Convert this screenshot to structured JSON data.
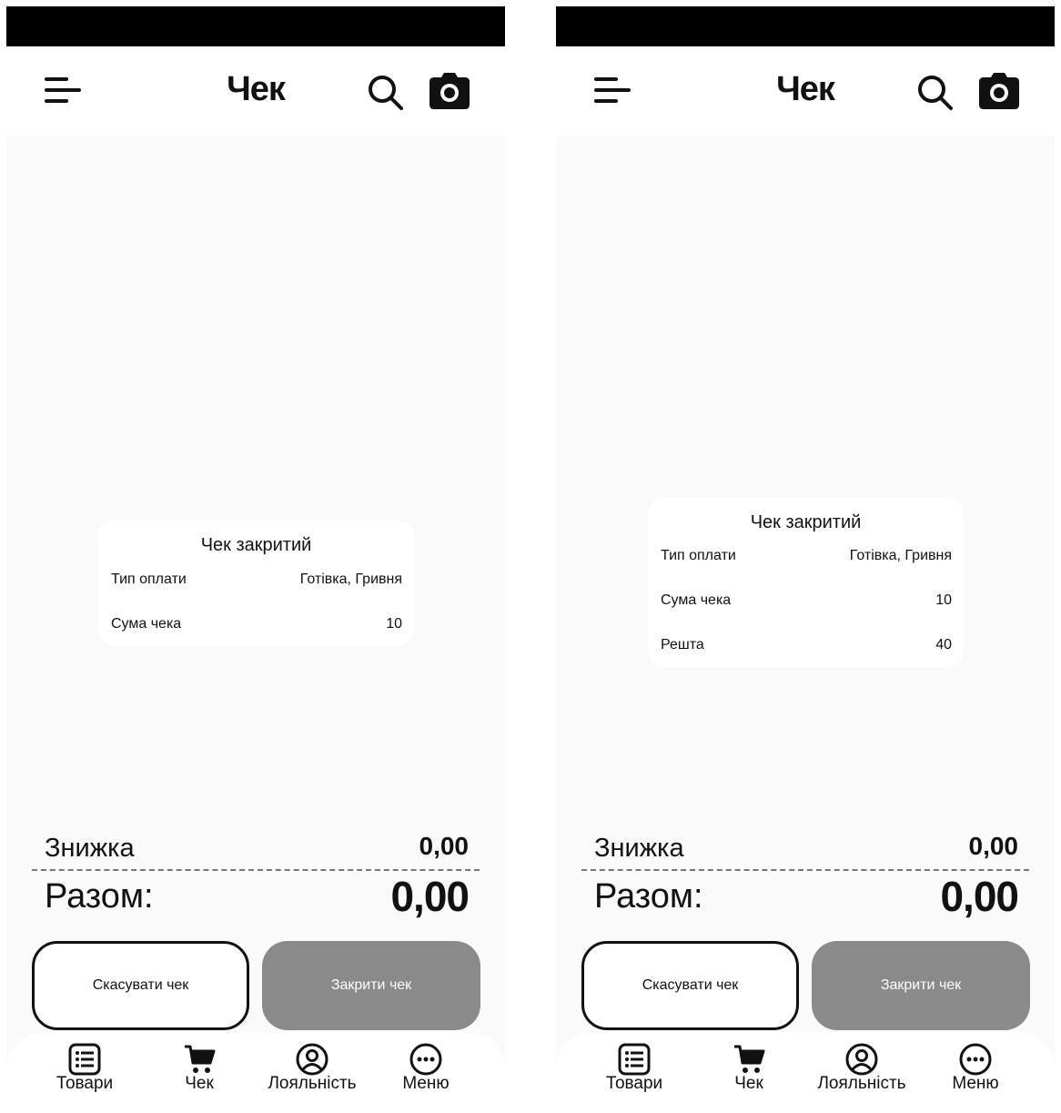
{
  "screens": [
    {
      "header": {
        "title": "Чек",
        "search_icon": "search-icon",
        "camera_icon": "camera-icon",
        "menu_icon": "hamburger-menu-icon"
      },
      "receipt": {
        "title": "Чек закритий",
        "rows": [
          {
            "label": "Тип оплати",
            "value": "Готівка, Гривня"
          },
          {
            "label": "Сума чека",
            "value": "10"
          }
        ]
      },
      "totals": {
        "discount_label": "Знижка",
        "discount_value": "0,00",
        "total_label": "Разом:",
        "total_value": "0,00"
      },
      "actions": {
        "cancel_label": "Скасувати чек",
        "close_label": "Закрити чек"
      },
      "nav": [
        {
          "label": "Товари",
          "icon": "list-icon"
        },
        {
          "label": "Чек",
          "icon": "cart-icon"
        },
        {
          "label": "Лояльність",
          "icon": "user-circle-icon"
        },
        {
          "label": "Меню",
          "icon": "more-dots-icon"
        }
      ]
    },
    {
      "header": {
        "title": "Чек",
        "search_icon": "search-icon",
        "camera_icon": "camera-icon",
        "menu_icon": "hamburger-menu-icon"
      },
      "receipt": {
        "title": "Чек закритий",
        "rows": [
          {
            "label": "Тип оплати",
            "value": "Готівка, Гривня"
          },
          {
            "label": "Сума чека",
            "value": "10"
          },
          {
            "label": "Решта",
            "value": "40"
          }
        ]
      },
      "totals": {
        "discount_label": "Знижка",
        "discount_value": "0,00",
        "total_label": "Разом:",
        "total_value": "0,00"
      },
      "actions": {
        "cancel_label": "Скасувати чек",
        "close_label": "Закрити чек"
      },
      "nav": [
        {
          "label": "Товари",
          "icon": "list-icon"
        },
        {
          "label": "Чек",
          "icon": "cart-icon"
        },
        {
          "label": "Лояльність",
          "icon": "user-circle-icon"
        },
        {
          "label": "Меню",
          "icon": "more-dots-icon"
        }
      ]
    }
  ],
  "colors": {
    "status_bar": "#000000",
    "background": "#fafafa",
    "card": "#ffffff",
    "close_button": "#8a8a8a",
    "text": "#111111"
  }
}
